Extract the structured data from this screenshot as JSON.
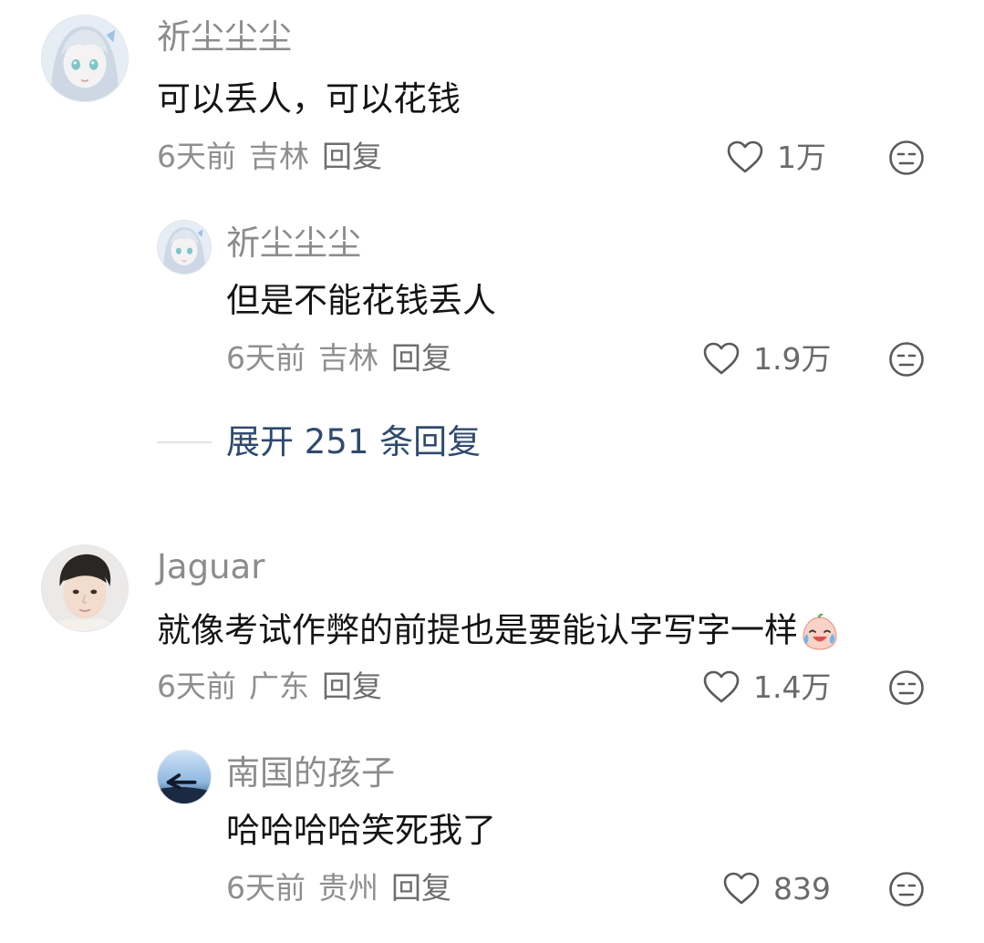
{
  "colors": {
    "username": "#8c8c8c",
    "text": "#141414",
    "meta": "#8f8f8f",
    "expand_link": "#2f4a6e",
    "background": "#ffffff"
  },
  "comments": [
    {
      "username": "祈尘尘尘",
      "text": "可以丢人，可以花钱",
      "time": "6天前",
      "location": "吉林",
      "reply_label": "回复",
      "likes": "1万",
      "avatar": "anime-girl-avatar"
    },
    {
      "username": "祈尘尘尘",
      "text": "但是不能花钱丢人",
      "time": "6天前",
      "location": "吉林",
      "reply_label": "回复",
      "likes": "1.9万",
      "avatar": "anime-girl-avatar"
    },
    {
      "username": "Jaguar",
      "text": "就像考试作弊的前提也是要能认字写字一样",
      "emoji": "crying-laughing-emoji",
      "time": "6天前",
      "location": "广东",
      "reply_label": "回复",
      "likes": "1.4万",
      "avatar": "young-man-avatar"
    },
    {
      "username": "南国的孩子",
      "text": "哈哈哈哈笑死我了",
      "time": "6天前",
      "location": "贵州",
      "reply_label": "回复",
      "likes": "839",
      "avatar": "sky-arrow-avatar"
    }
  ],
  "expand": {
    "label": "展开 251 条回复"
  }
}
